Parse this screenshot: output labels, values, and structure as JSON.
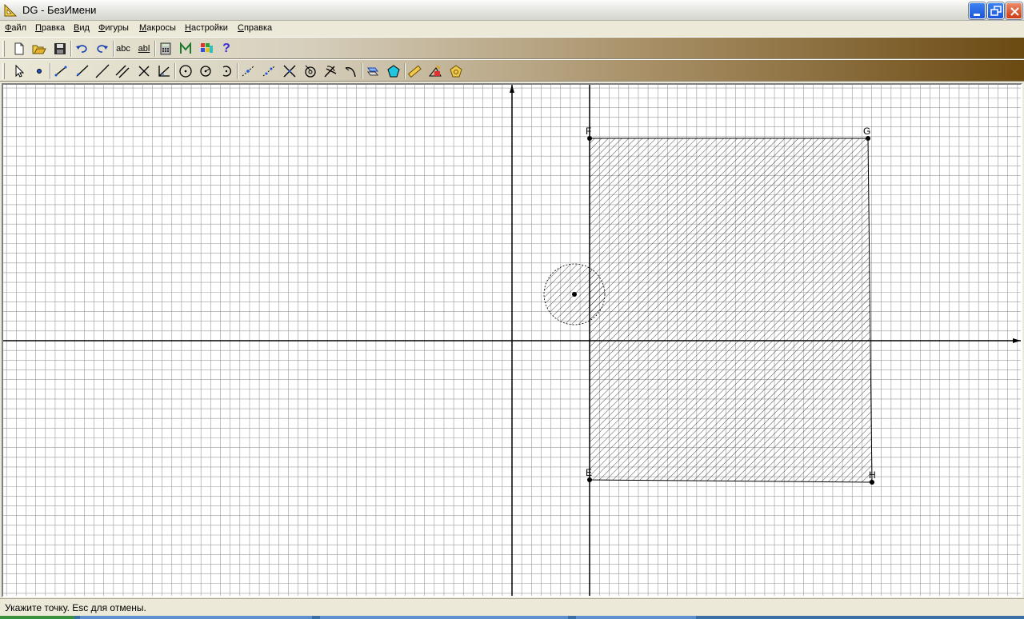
{
  "window": {
    "title": "DG - БезИмени",
    "app_icon": "triangle-ruler-icon"
  },
  "menu": {
    "items": [
      "Файл",
      "Правка",
      "Вид",
      "Фигуры",
      "Макросы",
      "Настройки",
      "Справка"
    ]
  },
  "toolbar1": {
    "buttons": [
      "new-file",
      "open-file",
      "save-file",
      "undo",
      "redo",
      "abc",
      "abl",
      "calculator",
      "macro-m",
      "color-palette",
      "help"
    ],
    "abc_label": "abc",
    "abl_label": "abl",
    "help_label": "?"
  },
  "toolbar2": {
    "tools": [
      "select-arrow",
      "point",
      "segment",
      "ray",
      "line",
      "parallel-lines",
      "intersect-lines",
      "angle",
      "circle",
      "circle-center-point",
      "arc",
      "midpoint",
      "divide-segment",
      "perpendicular",
      "compass",
      "bisector",
      "arc-tool",
      "transform",
      "polygon",
      "measure-ruler",
      "locus",
      "area"
    ]
  },
  "drawing": {
    "points": [
      {
        "label": "F"
      },
      {
        "label": "G"
      },
      {
        "label": "E"
      },
      {
        "label": "H"
      }
    ],
    "polygon_fill": "hatched",
    "circle_fill": "hatched"
  },
  "status": {
    "text": "Укажите точку. Esc для отмены."
  },
  "colors": {
    "grid": "#9a9a9a",
    "axis": "#000000",
    "toolbar_gradient_end": "#6b4a12",
    "accent_blue": "#1a55d8"
  }
}
